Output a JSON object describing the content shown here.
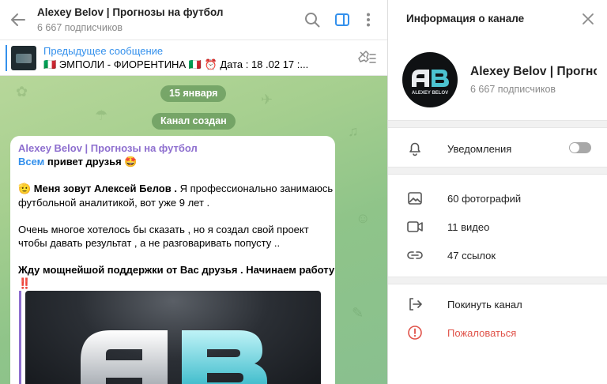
{
  "chat": {
    "title": "Alexey Belov | Прогнозы на футбол",
    "subscribers": "6 667 подписчиков",
    "pinned": {
      "label": "Предыдущее сообщение",
      "text": "🇮🇹 ЭМПОЛИ - ФИОРЕНТИНА 🇮🇹   ⏰ Дата : 18 .02  17 :..."
    },
    "date_pill": "15 января",
    "service_pill": "Канал создан",
    "message": {
      "author": "Alexey Belov | Прогнозы на футбол",
      "mention": "Всем",
      "line1_rest": " привет друзья 🤩",
      "line2_emoji": "🫡",
      "line2_bold": " Меня зовут Алексей Белов .",
      "line2_rest": " Я профессионально занимаюсь",
      "line3": "футбольной аналитикой, вот уже 9 лет .",
      "line4": "Очень многое хотелось бы сказать , но я создал свой проект",
      "line5": "чтобы давать результат , а не разговаривать попусту ..",
      "line6": "Жду мощнейшой поддержки от Вас друзья . Начинаем работу",
      "line7": "‼️"
    }
  },
  "info": {
    "title": "Информация о канале",
    "channel_name": "Alexey Belov | Прогнозы на футбол",
    "subscribers": "6 667 подписчиков",
    "avatar_text": "ALEXEY BELOV",
    "notifications": "Уведомления",
    "notifications_on": false,
    "photos": "60 фотографий",
    "videos": "11 видео",
    "links": "47 ссылок",
    "leave": "Покинуть канал",
    "report": "Пожаловаться"
  },
  "colors": {
    "accent": "#3390ec",
    "author": "#8e6fcf",
    "danger": "#e0534a",
    "chat_bg": "#a6cf8f"
  }
}
